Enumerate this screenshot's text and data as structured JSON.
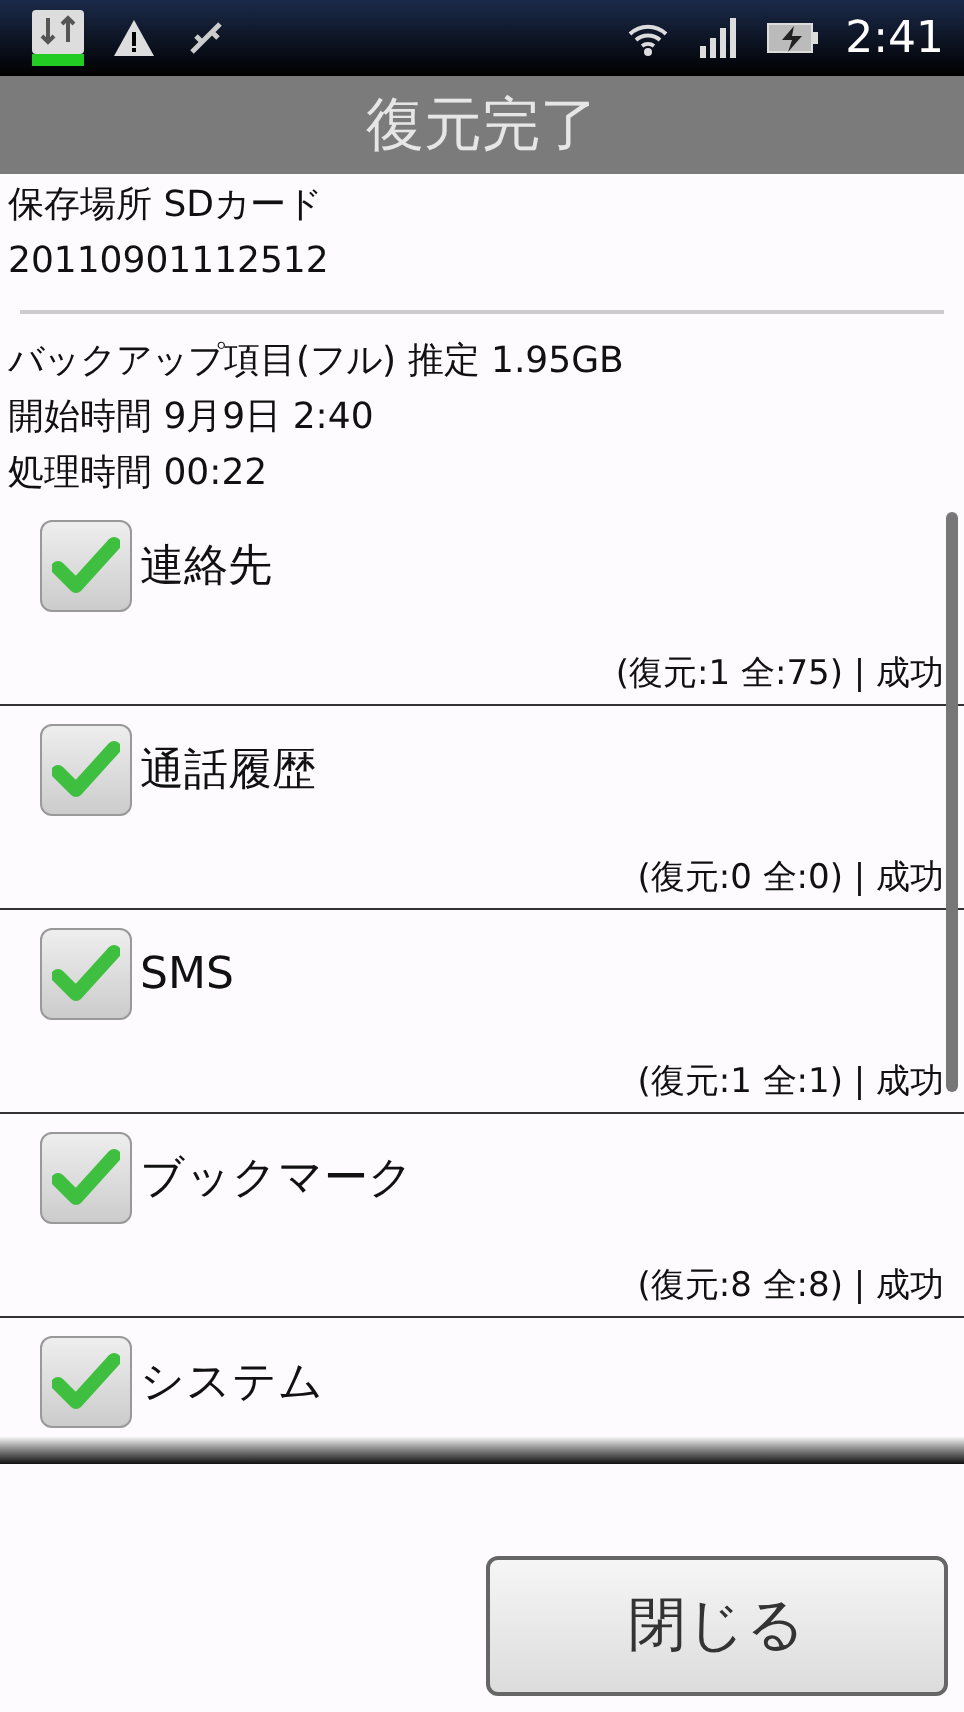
{
  "status_bar": {
    "time": "2:41"
  },
  "title": "復元完了",
  "info": [
    "保存場所 SDカード",
    "20110901112512"
  ],
  "details": [
    "バックアップ項目(フル) 推定 1.95GB",
    "開始時間 9月9日 2:40",
    "処理時間 00:22"
  ],
  "items": [
    {
      "label": "連絡先",
      "checked": true,
      "result": "(復元:1 全:75) | 成功"
    },
    {
      "label": "通話履歴",
      "checked": true,
      "result": "(復元:0 全:0) | 成功"
    },
    {
      "label": "SMS",
      "checked": true,
      "result": "(復元:1 全:1) | 成功"
    },
    {
      "label": "ブックマーク",
      "checked": true,
      "result": "(復元:8 全:8) | 成功"
    },
    {
      "label": "システム",
      "checked": true
    }
  ],
  "close_button": "閉じる"
}
